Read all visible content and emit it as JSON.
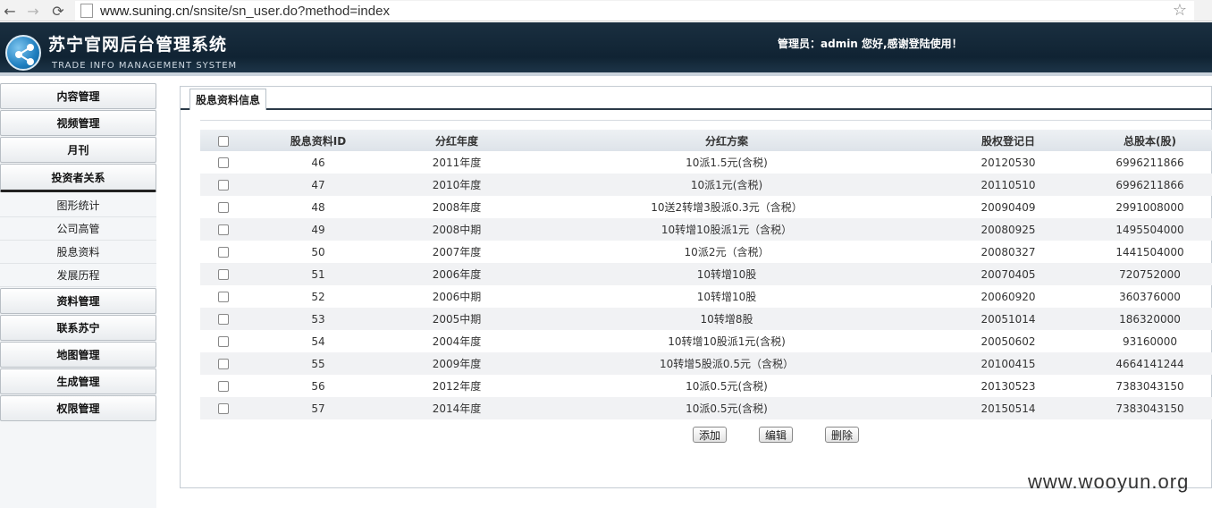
{
  "browser": {
    "url_host": "www.suning.cn",
    "url_path": "/snsite/sn_user.do?method=index"
  },
  "header": {
    "title": "苏宁官网后台管理系统",
    "subtitle": "TRADE INFO MANAGEMENT SYSTEM",
    "greeting": "管理员：admin 您好,感谢登陆使用！"
  },
  "sidebar": {
    "items": [
      {
        "label": "内容管理"
      },
      {
        "label": "视频管理"
      },
      {
        "label": "月刊"
      },
      {
        "label": "投资者关系"
      },
      {
        "label": "资料管理"
      },
      {
        "label": "联系苏宁"
      },
      {
        "label": "地图管理"
      },
      {
        "label": "生成管理"
      },
      {
        "label": "权限管理"
      }
    ],
    "sub_items": [
      {
        "label": "图形统计"
      },
      {
        "label": "公司高管"
      },
      {
        "label": "股息资料"
      },
      {
        "label": "发展历程"
      }
    ]
  },
  "main": {
    "tab": "股息资料信息",
    "columns": [
      "股息资料ID",
      "分红年度",
      "分红方案",
      "股权登记日",
      "总股本(股)"
    ],
    "rows": [
      [
        "46",
        "2011年度",
        "10派1.5元(含税)",
        "20120530",
        "6996211866"
      ],
      [
        "47",
        "2010年度",
        "10派1元(含税)",
        "20110510",
        "6996211866"
      ],
      [
        "48",
        "2008年度",
        "10送2转增3股派0.3元（含税）",
        "20090409",
        "2991008000"
      ],
      [
        "49",
        "2008中期",
        "10转增10股派1元（含税）",
        "20080925",
        "1495504000"
      ],
      [
        "50",
        "2007年度",
        "10派2元（含税）",
        "20080327",
        "1441504000"
      ],
      [
        "51",
        "2006年度",
        "10转增10股",
        "20070405",
        "720752000"
      ],
      [
        "52",
        "2006中期",
        "10转增10股",
        "20060920",
        "360376000"
      ],
      [
        "53",
        "2005中期",
        "10转增8股",
        "20051014",
        "186320000"
      ],
      [
        "54",
        "2004年度",
        "10转增10股派1元(含税)",
        "20050602",
        "93160000"
      ],
      [
        "55",
        "2009年度",
        "10转增5股派0.5元（含税）",
        "20100415",
        "4664141244"
      ],
      [
        "56",
        "2012年度",
        "10派0.5元(含税)",
        "20130523",
        "7383043150"
      ],
      [
        "57",
        "2014年度",
        "10派0.5元(含税)",
        "20150514",
        "7383043150"
      ]
    ],
    "buttons": {
      "add": "添加",
      "edit": "编辑",
      "delete": "删除"
    }
  },
  "watermark": "www.wooyun.org"
}
